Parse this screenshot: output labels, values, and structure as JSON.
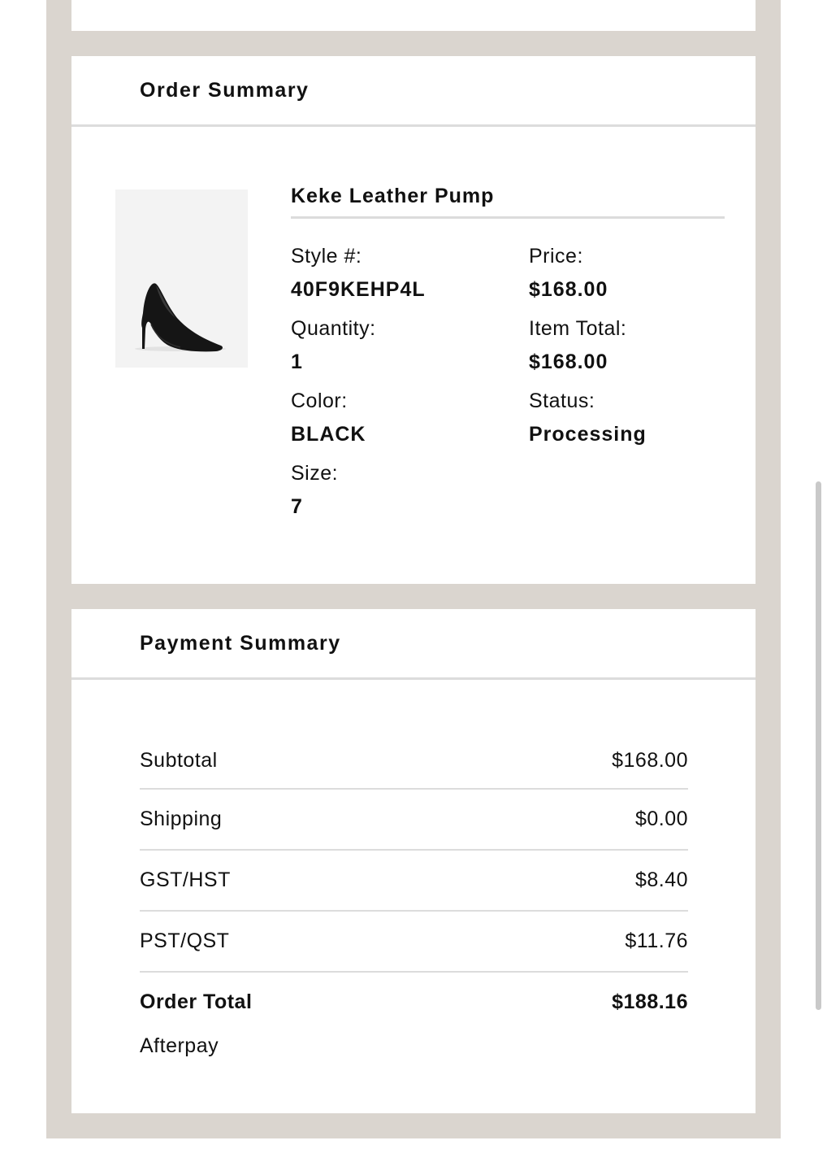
{
  "order_summary": {
    "title": "Order Summary",
    "product": {
      "name": "Keke Leather Pump",
      "image_icon": "black-pump-shoe-image",
      "style_label": "Style #:",
      "style_value": "40F9KEHP4L",
      "quantity_label": "Quantity:",
      "quantity_value": "1",
      "color_label": "Color:",
      "color_value": "BLACK",
      "size_label": "Size:",
      "size_value": "7",
      "price_label": "Price:",
      "price_value": "$168.00",
      "item_total_label": "Item Total:",
      "item_total_value": "$168.00",
      "status_label": "Status:",
      "status_value": "Processing"
    }
  },
  "payment_summary": {
    "title": "Payment Summary",
    "rows": [
      {
        "label": "Subtotal",
        "value": "$168.00"
      },
      {
        "label": "Shipping",
        "value": "$0.00"
      },
      {
        "label": "GST/HST",
        "value": "$8.40"
      },
      {
        "label": "PST/QST",
        "value": "$11.76"
      }
    ],
    "total_label": "Order Total",
    "total_value": "$188.16",
    "payment_method": "Afterpay"
  },
  "colors": {
    "frame": "#dad5cf",
    "divider": "#dcdcdc",
    "text": "#111111"
  }
}
